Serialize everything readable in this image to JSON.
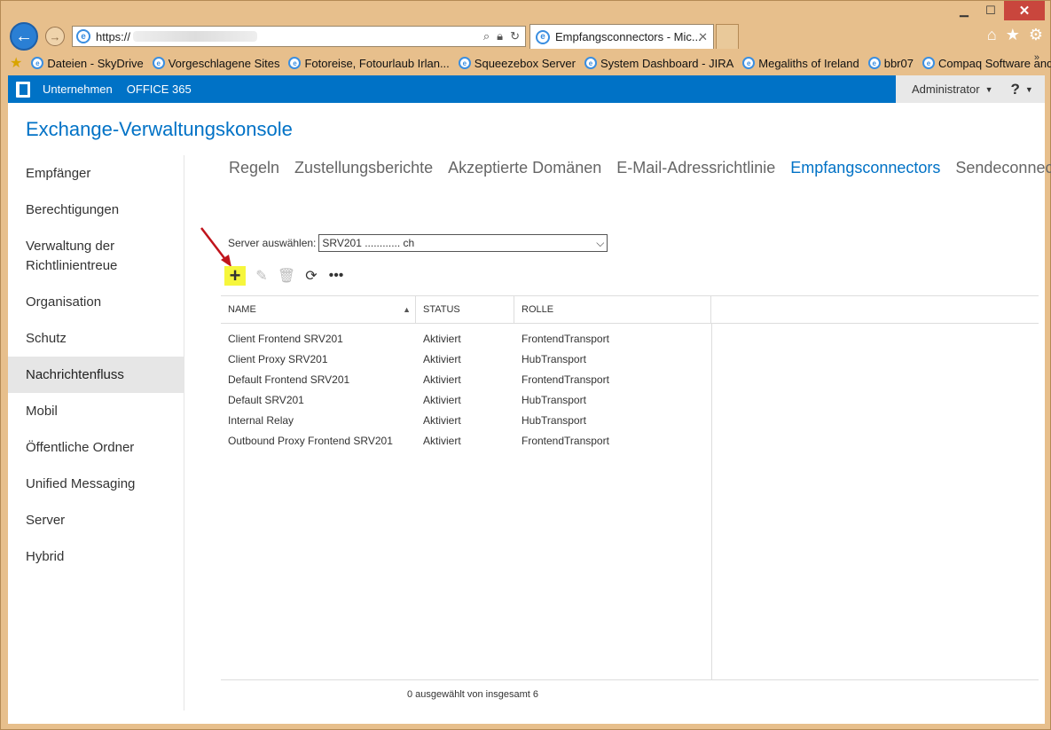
{
  "browser": {
    "url_prefix": "https://",
    "url_suffix": "",
    "tab_title": "Empfangsconnectors - Mic...",
    "window_controls": [
      "minimize-icon",
      "maximize-icon",
      "close-icon"
    ],
    "favorites": [
      "Dateien - SkyDrive",
      "Vorgeschlagene Sites",
      "Fotoreise, Fotourlaub Irlan...",
      "Squeezebox Server",
      "System Dashboard - JIRA",
      "Megaliths of Ireland",
      "bbr07",
      "Compaq Software and Dri..."
    ],
    "favorites_more": "»"
  },
  "topbar": {
    "company": "Unternehmen",
    "office": "OFFICE 365",
    "user": "Administrator",
    "help": "?"
  },
  "title": "Exchange-Verwaltungskonsole",
  "sidenav": [
    "Empfänger",
    "Berechtigungen",
    "Verwaltung der Richtlinientreue",
    "Organisation",
    "Schutz",
    "Nachrichtenfluss",
    "Mobil",
    "Öffentliche Ordner",
    "Unified Messaging",
    "Server",
    "Hybrid"
  ],
  "sidenav_active": "Nachrichtenfluss",
  "subnav": [
    "Regeln",
    "Zustellungsberichte",
    "Akzeptierte Domänen",
    "E-Mail-Adressrichtlinie",
    "Empfangsconnectors",
    "Sendeconnectors"
  ],
  "subnav_active": "Empfangsconnectors",
  "server_select": {
    "label": "Server auswählen:",
    "value": "SRV201 ............ ch"
  },
  "table": {
    "headers": [
      "NAME",
      "STATUS",
      "ROLLE"
    ],
    "rows": [
      [
        "Client Frontend SRV201",
        "Aktiviert",
        "FrontendTransport"
      ],
      [
        "Client Proxy SRV201",
        "Aktiviert",
        "HubTransport"
      ],
      [
        "Default Frontend SRV201",
        "Aktiviert",
        "FrontendTransport"
      ],
      [
        "Default SRV201",
        "Aktiviert",
        "HubTransport"
      ],
      [
        "Internal Relay",
        "Aktiviert",
        "HubTransport"
      ],
      [
        "Outbound Proxy Frontend SRV201",
        "Aktiviert",
        "FrontendTransport"
      ]
    ]
  },
  "footer": "0 ausgewählt von insgesamt 6",
  "colors": {
    "accent": "#0072c6",
    "highlight": "#f6f63c",
    "arrow": "#c0141c"
  }
}
